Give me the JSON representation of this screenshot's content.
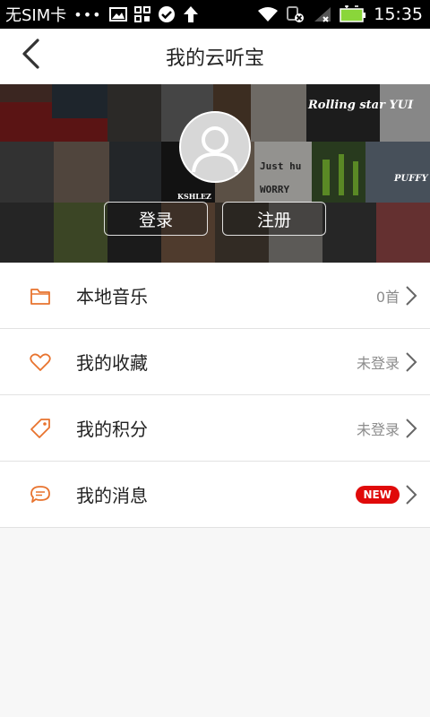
{
  "status_bar": {
    "carrier": "无SIM卡",
    "dots": "•••",
    "time": "15:35",
    "icons": [
      "image-icon",
      "apps-icon",
      "check-circle-icon",
      "upload-arrow-icon",
      "wifi-icon",
      "data-off-icon",
      "signal-icon",
      "battery-charging-icon"
    ]
  },
  "header": {
    "title": "我的云听宝",
    "back_icon": "chevron-left-icon"
  },
  "banner": {
    "album_texts": [
      "Rolling star YUI",
      "Just hu",
      "PUFFY",
      "WORRY",
      "KSHLEZ"
    ],
    "login_label": "登录",
    "register_label": "注册",
    "avatar_icon": "user-avatar-icon"
  },
  "menu": [
    {
      "icon": "folder-icon",
      "label": "本地音乐",
      "status": "0首"
    },
    {
      "icon": "heart-icon",
      "label": "我的收藏",
      "status": "未登录"
    },
    {
      "icon": "tag-icon",
      "label": "我的积分",
      "status": "未登录"
    },
    {
      "icon": "message-icon",
      "label": "我的消息",
      "badge": "NEW"
    }
  ],
  "colors": {
    "accent": "#e8732e",
    "badge_red": "#e00a0a",
    "status_gray": "#8c8c8c"
  }
}
